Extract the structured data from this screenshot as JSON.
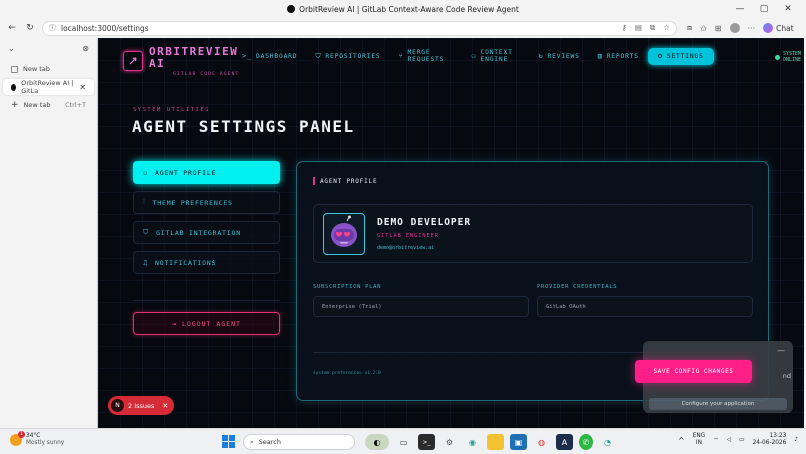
{
  "browser": {
    "window_title": "OrbitReview AI | GitLab Context-Aware Code Review Agent",
    "url": "localhost:3000/settings",
    "chat_label": "Chat",
    "tabs": [
      {
        "label": "New tab",
        "active": false
      },
      {
        "label": "OrbitReview AI | GitLa",
        "active": true
      }
    ],
    "new_tab_label": "New tab",
    "new_tab_shortcut": "Ctrl+T"
  },
  "app": {
    "brand_name_line1": "ORBITREVIEW",
    "brand_name_line2": "AI",
    "brand_subtitle": "GITLAB CODE AGENT",
    "nav": [
      {
        "label": "DASHBOARD",
        "icon": "terminal-icon",
        "glyph": ">_",
        "active": false
      },
      {
        "label": "REPOSITORIES",
        "icon": "shield-icon",
        "glyph": "⛉",
        "active": false
      },
      {
        "label": "MERGE REQUESTS",
        "icon": "merge-icon",
        "glyph": "⑂",
        "active": false
      },
      {
        "label": "CONTEXT ENGINE",
        "icon": "user-icon",
        "glyph": "⚇",
        "active": false
      },
      {
        "label": "REVIEWS",
        "icon": "refresh-icon",
        "glyph": "↻",
        "active": false
      },
      {
        "label": "REPORTS",
        "icon": "bar-chart-icon",
        "glyph": "▥",
        "active": false
      },
      {
        "label": "SETTINGS",
        "icon": "gear-icon",
        "glyph": "⚙",
        "active": true
      }
    ],
    "system_status": "SYSTEM ONLINE",
    "section_kicker": "SYSTEM UTILITIES",
    "page_title": "AGENT SETTINGS PANEL",
    "menu": [
      {
        "label": "AGENT PROFILE",
        "icon": "user-icon",
        "glyph": "⚇",
        "active": true
      },
      {
        "label": "THEME PREFERENCES",
        "icon": "sliders-icon",
        "glyph": "⫶",
        "active": false
      },
      {
        "label": "GITLAB INTEGRATION",
        "icon": "shield-icon",
        "glyph": "⛉",
        "active": false
      },
      {
        "label": "NOTIFICATIONS",
        "icon": "bell-icon",
        "glyph": "♫",
        "active": false
      }
    ],
    "logout_label": "LOGOUT AGENT",
    "card_title": "AGENT PROFILE",
    "profile": {
      "name": "DEMO DEVELOPER",
      "role": "GITLAB ENGINEER",
      "email": "demo@orbitreview.ai"
    },
    "subscription_label": "SUBSCRIPTION PLAN",
    "subscription_value": "Enterprise (Trial)",
    "provider_label": "PROVIDER CREDENTIALS",
    "provider_value": "GitLab OAuth",
    "version_text": "system preferences v1.2.0",
    "save_label": "SAVE CONFIG CHANGES",
    "popup_partial_text": "nd",
    "popup_button": "Configure your application",
    "issues_label": "2 Issues",
    "issues_badge": "N"
  },
  "taskbar": {
    "temperature": "34°C",
    "condition": "Mostly sunny",
    "weather_badge": "1",
    "search_placeholder": "Search",
    "language_line1": "ENG",
    "language_line2": "IN",
    "time": "13:23",
    "date": "24-06-2026"
  },
  "colors": {
    "accent_cyan": "#00f0f0",
    "accent_pink": "#ff1f86",
    "background": "#06090f"
  }
}
